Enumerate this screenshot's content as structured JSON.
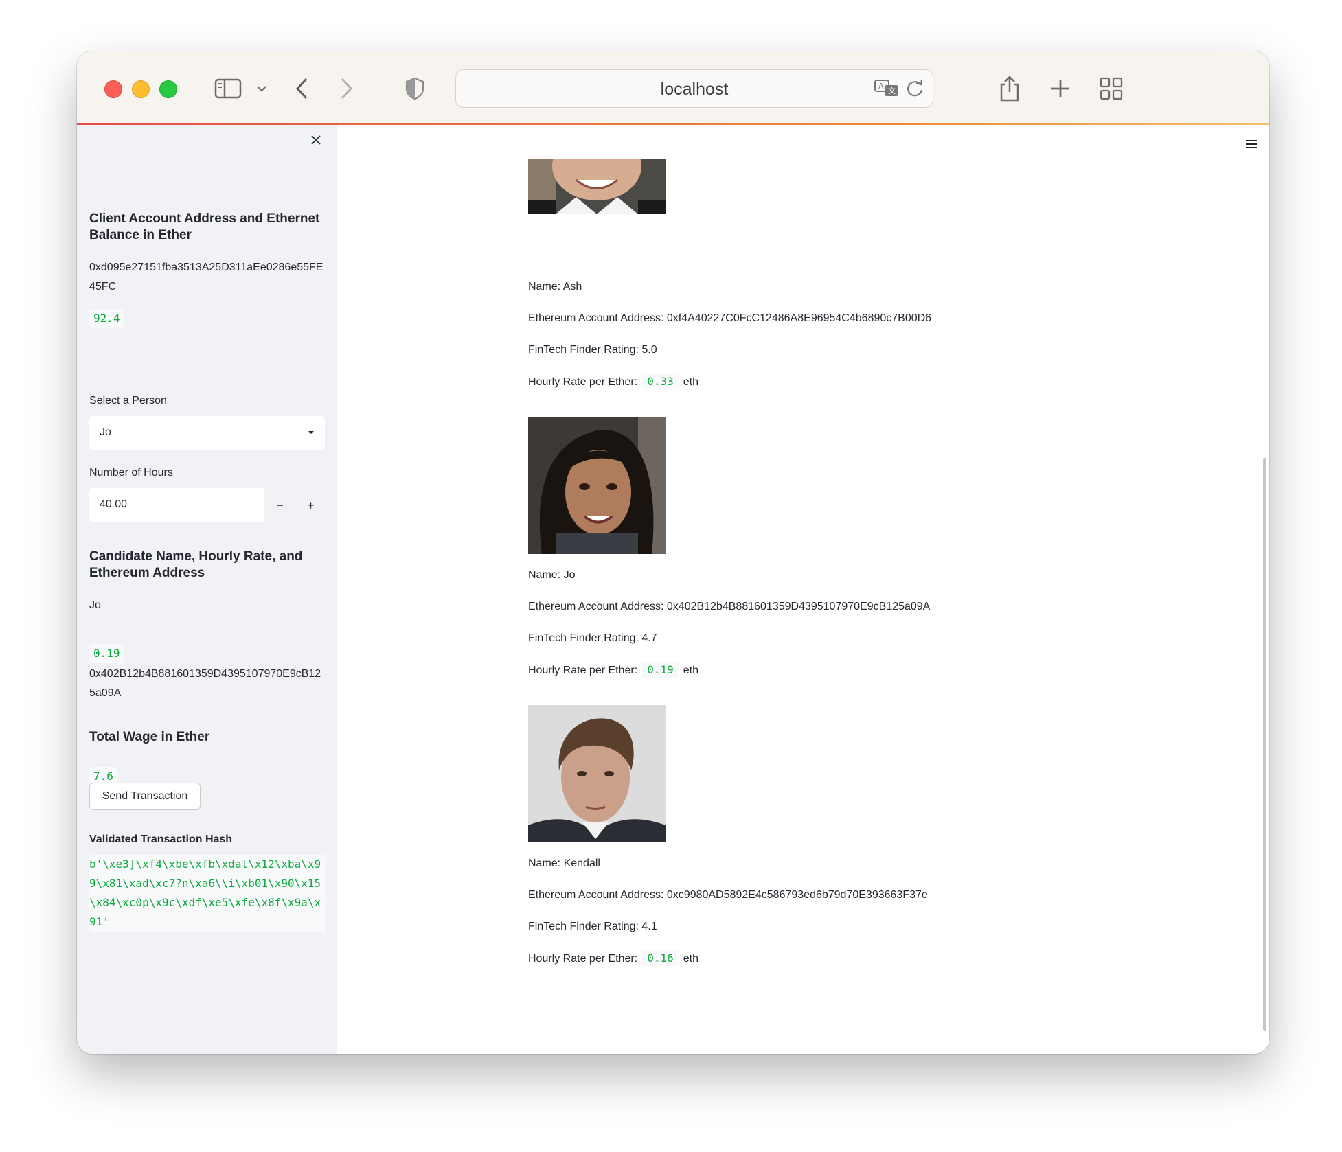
{
  "browser": {
    "url": "localhost"
  },
  "sidebar": {
    "balance_heading": "Client Account Address and Ethernet Balance in Ether",
    "client_address": "0xd095e27151fba3513A25D311aEe0286e55FE45FC",
    "balance": "92.4",
    "select_label": "Select a Person",
    "selected_person": "Jo",
    "hours_label": "Number of Hours",
    "hours_value": "40.00",
    "minus": "−",
    "plus": "+",
    "candidate_heading": "Candidate Name, Hourly Rate, and Ethereum Address",
    "candidate_name": "Jo",
    "candidate_rate": "0.19",
    "candidate_address": "0x402B12b4B881601359D4395107970E9cB125a09A",
    "wage_heading": "Total Wage in Ether",
    "wage_value": "7.6",
    "send_button": "Send Transaction",
    "hash_heading": "Validated Transaction Hash",
    "hash_value": "b'\\xe3]\\xf4\\xbe\\xfb\\xdal\\x12\\xba\\x99\\x81\\xad\\xc7?n\\xa6\\\\i\\xb01\\x90\\x15\\x84\\xc0p\\x9c\\xdf\\xe5\\xfe\\x8f\\x9a\\x91'"
  },
  "candidates": [
    {
      "name": "Name: Ash",
      "address": "Ethereum Account Address: 0xf4A40227C0FcC12486A8E96954C4b6890c7B00D6",
      "rating": "FinTech Finder Rating: 5.0",
      "rate_label": "Hourly Rate per Ether:",
      "rate": "0.33",
      "unit": "eth"
    },
    {
      "name": "Name: Jo",
      "address": "Ethereum Account Address: 0x402B12b4B881601359D4395107970E9cB125a09A",
      "rating": "FinTech Finder Rating: 4.7",
      "rate_label": "Hourly Rate per Ether:",
      "rate": "0.19",
      "unit": "eth"
    },
    {
      "name": "Name: Kendall",
      "address": "Ethereum Account Address: 0xc9980AD5892E4c586793ed6b79d70E393663F37e",
      "rating": "FinTech Finder Rating: 4.1",
      "rate_label": "Hourly Rate per Ether:",
      "rate": "0.16",
      "unit": "eth"
    }
  ],
  "icons": {
    "close": "close-icon",
    "menu": "hamburger-menu-icon",
    "sidebar": "sidebar-toggle-icon",
    "back": "chevron-left-icon",
    "forward": "chevron-right-icon",
    "shield": "shield-icon",
    "translate": "translate-icon",
    "reload": "reload-icon",
    "share": "share-icon",
    "new_tab": "plus-icon",
    "tabs": "tab-overview-icon"
  },
  "colors": {
    "accent_green": "#09ab3b",
    "sidebar_bg": "#f0f2f6",
    "text": "#262730"
  }
}
